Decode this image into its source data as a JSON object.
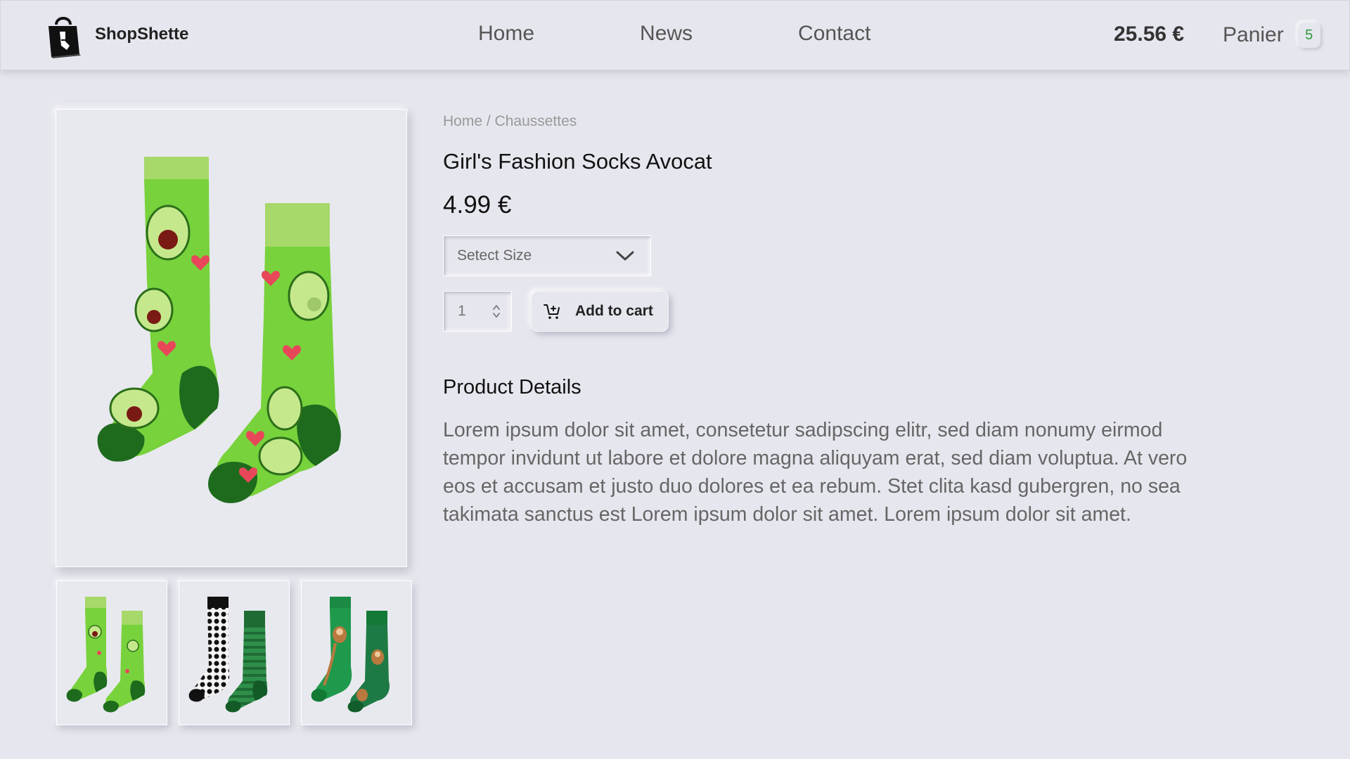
{
  "header": {
    "brand_name": "ShopShette",
    "nav": [
      {
        "label": "Home"
      },
      {
        "label": "News"
      },
      {
        "label": "Contact"
      }
    ],
    "cart_total": "25.56 €",
    "cart_label": "Panier",
    "cart_count": "5"
  },
  "product": {
    "breadcrumb": {
      "home": "Home",
      "separator": " / ",
      "category": "Chaussettes"
    },
    "title": "Girl's Fashion Socks Avocat",
    "price": "4.99 €",
    "size_placeholder": "Setect Size",
    "quantity": "1",
    "add_to_cart": "Add to cart",
    "details_heading": "Product Details",
    "description": "Lorem ipsum dolor sit amet, consetetur sadipscing elitr, sed diam nonumy eirmod tempor invidunt ut labore et dolore magna aliquyam erat, sed diam voluptua. At vero eos et accusam et justo duo dolores et ea rebum. Stet clita kasd gubergren, no sea takimata sanctus est Lorem ipsum dolor sit amet. Lorem ipsum dolor sit amet."
  },
  "gallery": {
    "main_image": "avocado-socks-image",
    "thumbnails": [
      "avocado-socks-thumbnail",
      "football-socks-thumbnail",
      "monkey-socks-thumbnail"
    ]
  },
  "colors": {
    "background": "#e6e7ee",
    "badge_text": "#2e9a3c",
    "sock_lime": "#78d23c",
    "sock_dark_green": "#1e6b1e",
    "sock_cuff": "#a7d86a",
    "heart": "#e8475a"
  },
  "icons": {
    "logo": "shopping-bag-icon",
    "dropdown": "chevron-down-icon",
    "stepper": "stepper-icon",
    "cart": "cart-plus-icon"
  }
}
